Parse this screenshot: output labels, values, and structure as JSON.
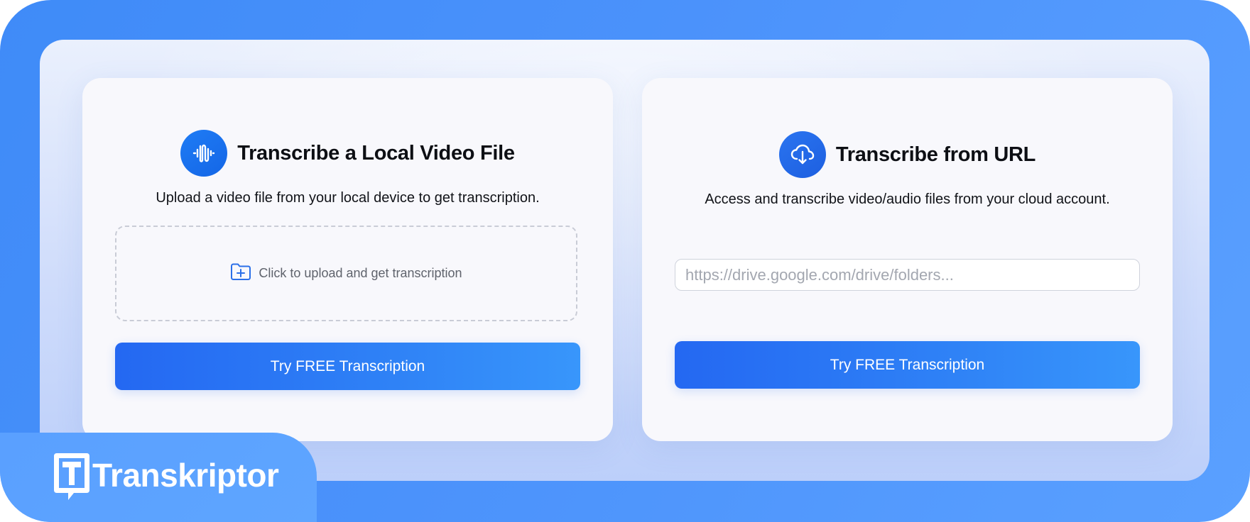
{
  "local_card": {
    "icon": "audio-wave-icon",
    "title": "Transcribe a Local Video File",
    "description": "Upload a video file from your local device to get transcription.",
    "dropzone": {
      "icon": "folder-plus-icon",
      "text": "Click to upload and get transcription"
    },
    "button_label": "Try FREE Transcription"
  },
  "url_card": {
    "icon": "cloud-download-icon",
    "title": "Transcribe from URL",
    "description": "Access and transcribe video/audio files from your cloud account.",
    "input": {
      "value": "",
      "placeholder": "https://drive.google.com/drive/folders..."
    },
    "button_label": "Try FREE Transcription"
  },
  "brand": {
    "logo_icon": "transkriptor-logo-icon",
    "name": "Transkriptor"
  },
  "colors": {
    "frame_blue": "#4b92fb",
    "accent_blue": "#1f7cf5",
    "button_start": "#2468f2",
    "button_end": "#3896fb",
    "card_background": "#f8f8fc",
    "title_text": "#0d0f14"
  }
}
